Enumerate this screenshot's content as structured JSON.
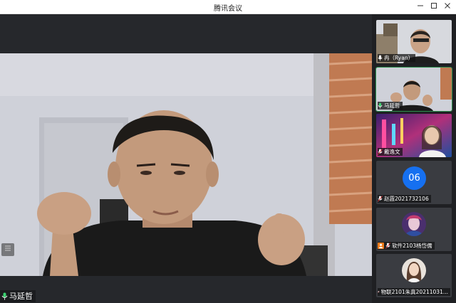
{
  "window": {
    "title": "腾讯会议",
    "min_icon": "minimize-icon",
    "max_icon": "maximize-icon",
    "close_icon": "close-icon"
  },
  "main": {
    "speaker_name": "马延哲",
    "speaker_mic_icon": "mic-on-icon",
    "side_toggle_icon": "list-icon"
  },
  "participants": [
    {
      "name": "冉（Ryan）",
      "mic_icon": "mic-on-icon",
      "video": true
    },
    {
      "name": "马延哲",
      "mic_icon": "mic-on-icon",
      "video": true,
      "active": true
    },
    {
      "name": "戴逸文",
      "mic_icon": "mic-muted-icon",
      "video": true
    },
    {
      "name": "赵霞2021732106",
      "mic_icon": "mic-muted-icon",
      "video": false,
      "avatar_text": "06",
      "avatar_color": "#1670f0"
    },
    {
      "name": "软件2103杨岱儒",
      "mic_icon": "mic-muted-icon",
      "video": false,
      "badge": "person-icon",
      "badge_color": "#f07b1a"
    },
    {
      "name": "物联2101朱真20211031...",
      "mic_icon": "mic-muted-icon",
      "video": false
    }
  ]
}
